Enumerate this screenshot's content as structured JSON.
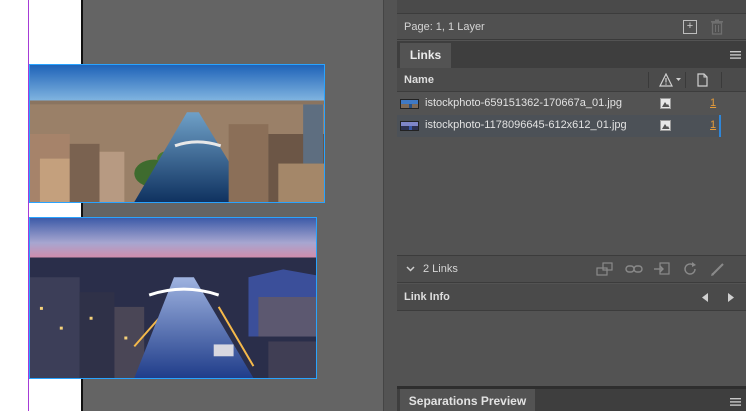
{
  "canvas": {
    "images": [
      {
        "name": "Dublin river panorama by day"
      },
      {
        "name": "Dublin river panorama at dusk"
      }
    ]
  },
  "layers_panel": {
    "page_info": "Page: 1, 1 Layer",
    "new_layer_icon": "plus-square-icon",
    "delete_icon": "trash-icon"
  },
  "links_panel": {
    "tab_label": "Links",
    "column_name": "Name",
    "links": [
      {
        "name": "istockphoto-659151362-170667a_01.jpg",
        "page": "1",
        "status_icon": "embedded-icon",
        "selected": false
      },
      {
        "name": "istockphoto-1178096645-612x612_01.jpg",
        "page": "1",
        "status_icon": "embedded-icon",
        "selected": true
      }
    ],
    "count_label": "2 Links",
    "footer_tools": [
      "relink-from-cc-icon",
      "relink-icon",
      "goto-link-icon",
      "update-link-icon",
      "edit-original-icon"
    ]
  },
  "link_info": {
    "title": "Link Info"
  },
  "separations": {
    "tab_label": "Separations Preview"
  },
  "colors": {
    "selection_blue": "#29a3ff",
    "page_link_orange": "#e49b3a",
    "guide_purple": "#a63bd6"
  }
}
